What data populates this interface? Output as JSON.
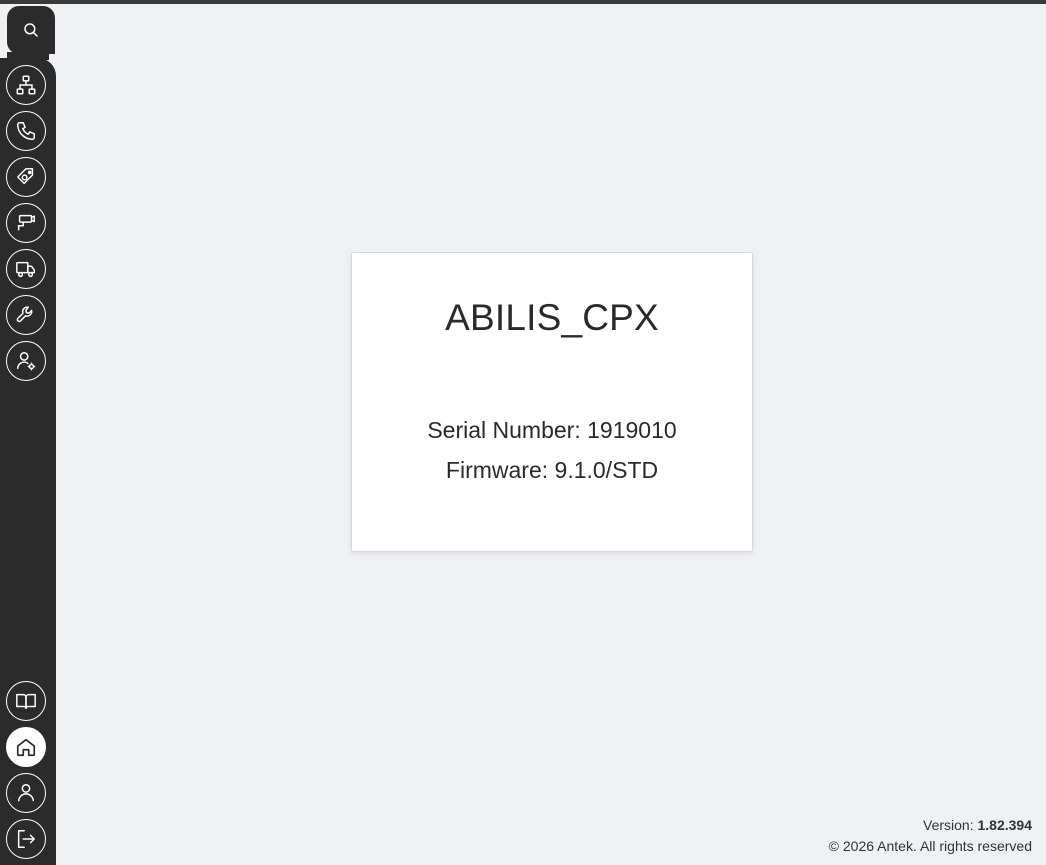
{
  "sidebar": {
    "search": {
      "icon": "search-icon"
    },
    "top_items": [
      {
        "name": "network",
        "icon": "network-icon"
      },
      {
        "name": "phone",
        "icon": "phone-icon"
      },
      {
        "name": "tools-config",
        "icon": "settings-tag-icon"
      },
      {
        "name": "camera",
        "icon": "security-camera-icon"
      },
      {
        "name": "delivery",
        "icon": "truck-icon"
      },
      {
        "name": "maintenance",
        "icon": "wrench-icon"
      },
      {
        "name": "user-settings",
        "icon": "user-gear-icon"
      }
    ],
    "bottom_items": [
      {
        "name": "manual",
        "icon": "book-icon"
      },
      {
        "name": "home",
        "icon": "home-icon",
        "active": true
      },
      {
        "name": "profile",
        "icon": "user-icon"
      },
      {
        "name": "logout",
        "icon": "logout-icon"
      }
    ]
  },
  "device": {
    "name": "ABILIS_CPX",
    "serial_label": "Serial Number:",
    "serial_value": "1919010",
    "firmware_label": "Firmware:",
    "firmware_value": "9.1.0/STD"
  },
  "footer": {
    "version_label": "Version:",
    "version_value": "1.82.394",
    "copyright": "© 2026 Antek. All rights reserved"
  },
  "colors": {
    "sidebar": "#2b2b2b",
    "background": "#f0f1f3",
    "card": "#ffffff"
  }
}
